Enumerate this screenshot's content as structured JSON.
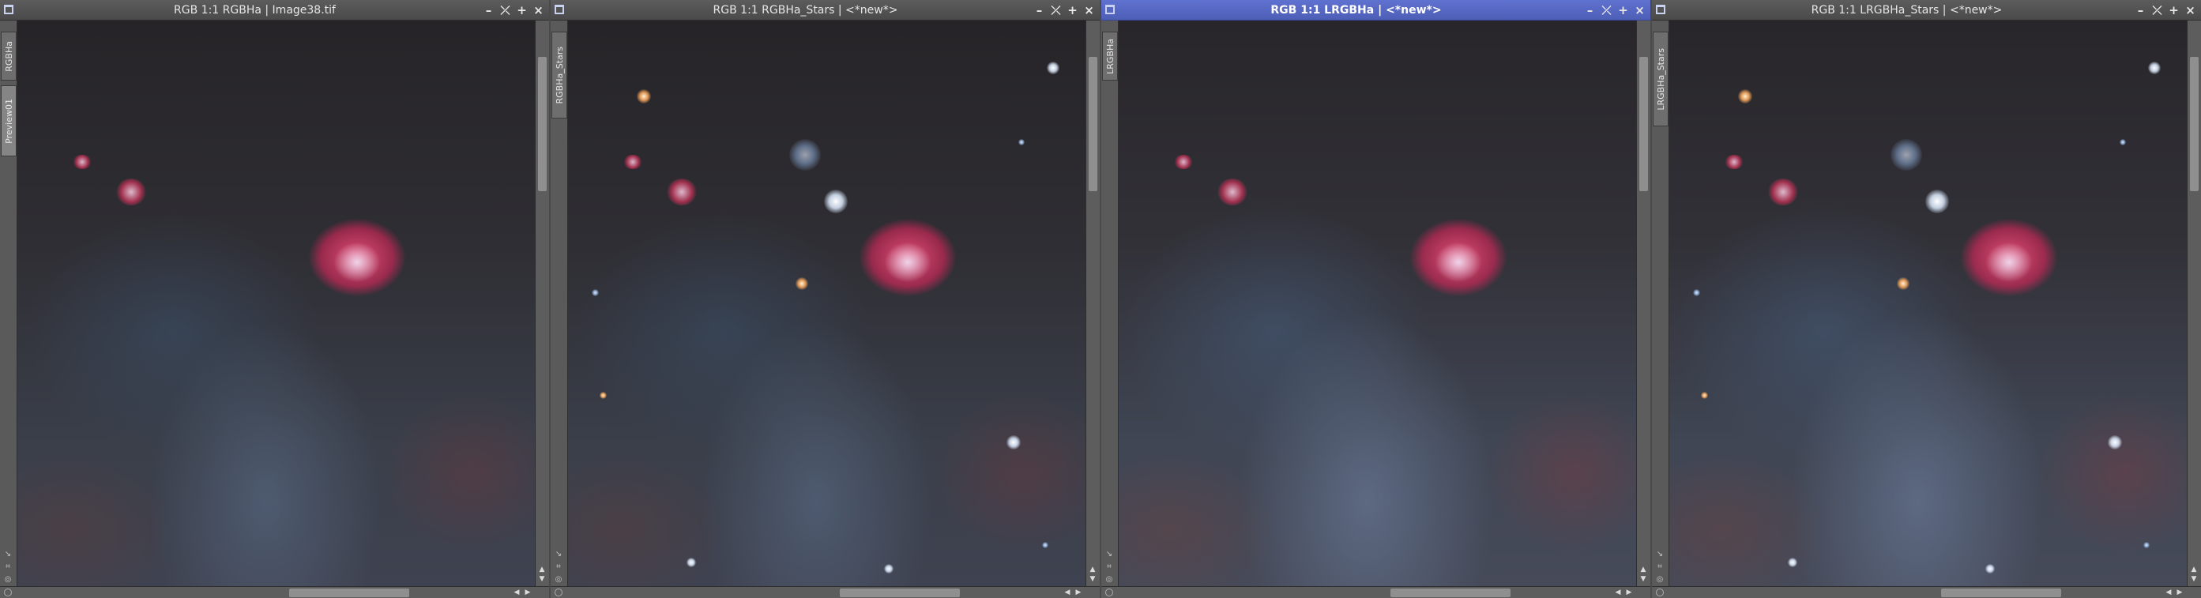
{
  "windows": [
    {
      "title": "RGB 1:1 RGBHa | Image38.tif",
      "tabs": [
        "RGBHa",
        "Preview01"
      ],
      "active": false
    },
    {
      "title": "RGB 1:1 RGBHa_Stars | <*new*>",
      "tabs": [
        "RGBHa_Stars"
      ],
      "active": false
    },
    {
      "title": "RGB 1:1 LRGBHa | <*new*>",
      "tabs": [
        "LRGBHa"
      ],
      "active": true
    },
    {
      "title": "RGB 1:1 LRGBHa_Stars | <*new*>",
      "tabs": [
        "LRGBHa_Stars"
      ],
      "active": false
    }
  ],
  "window_controls": {
    "minimize": "–",
    "shade": "⤫",
    "maximize": "+",
    "close": "×"
  },
  "icons": {
    "window": "window-icon",
    "scroll_up": "▲",
    "scroll_down": "▼",
    "scroll_left": "◀",
    "scroll_right": "▶",
    "side": [
      "↘",
      "⌗",
      "◎"
    ]
  },
  "colors": {
    "active_title": "#5061b8",
    "inactive_title": "#4e4e4e",
    "workspace": "#4a4a4a"
  }
}
